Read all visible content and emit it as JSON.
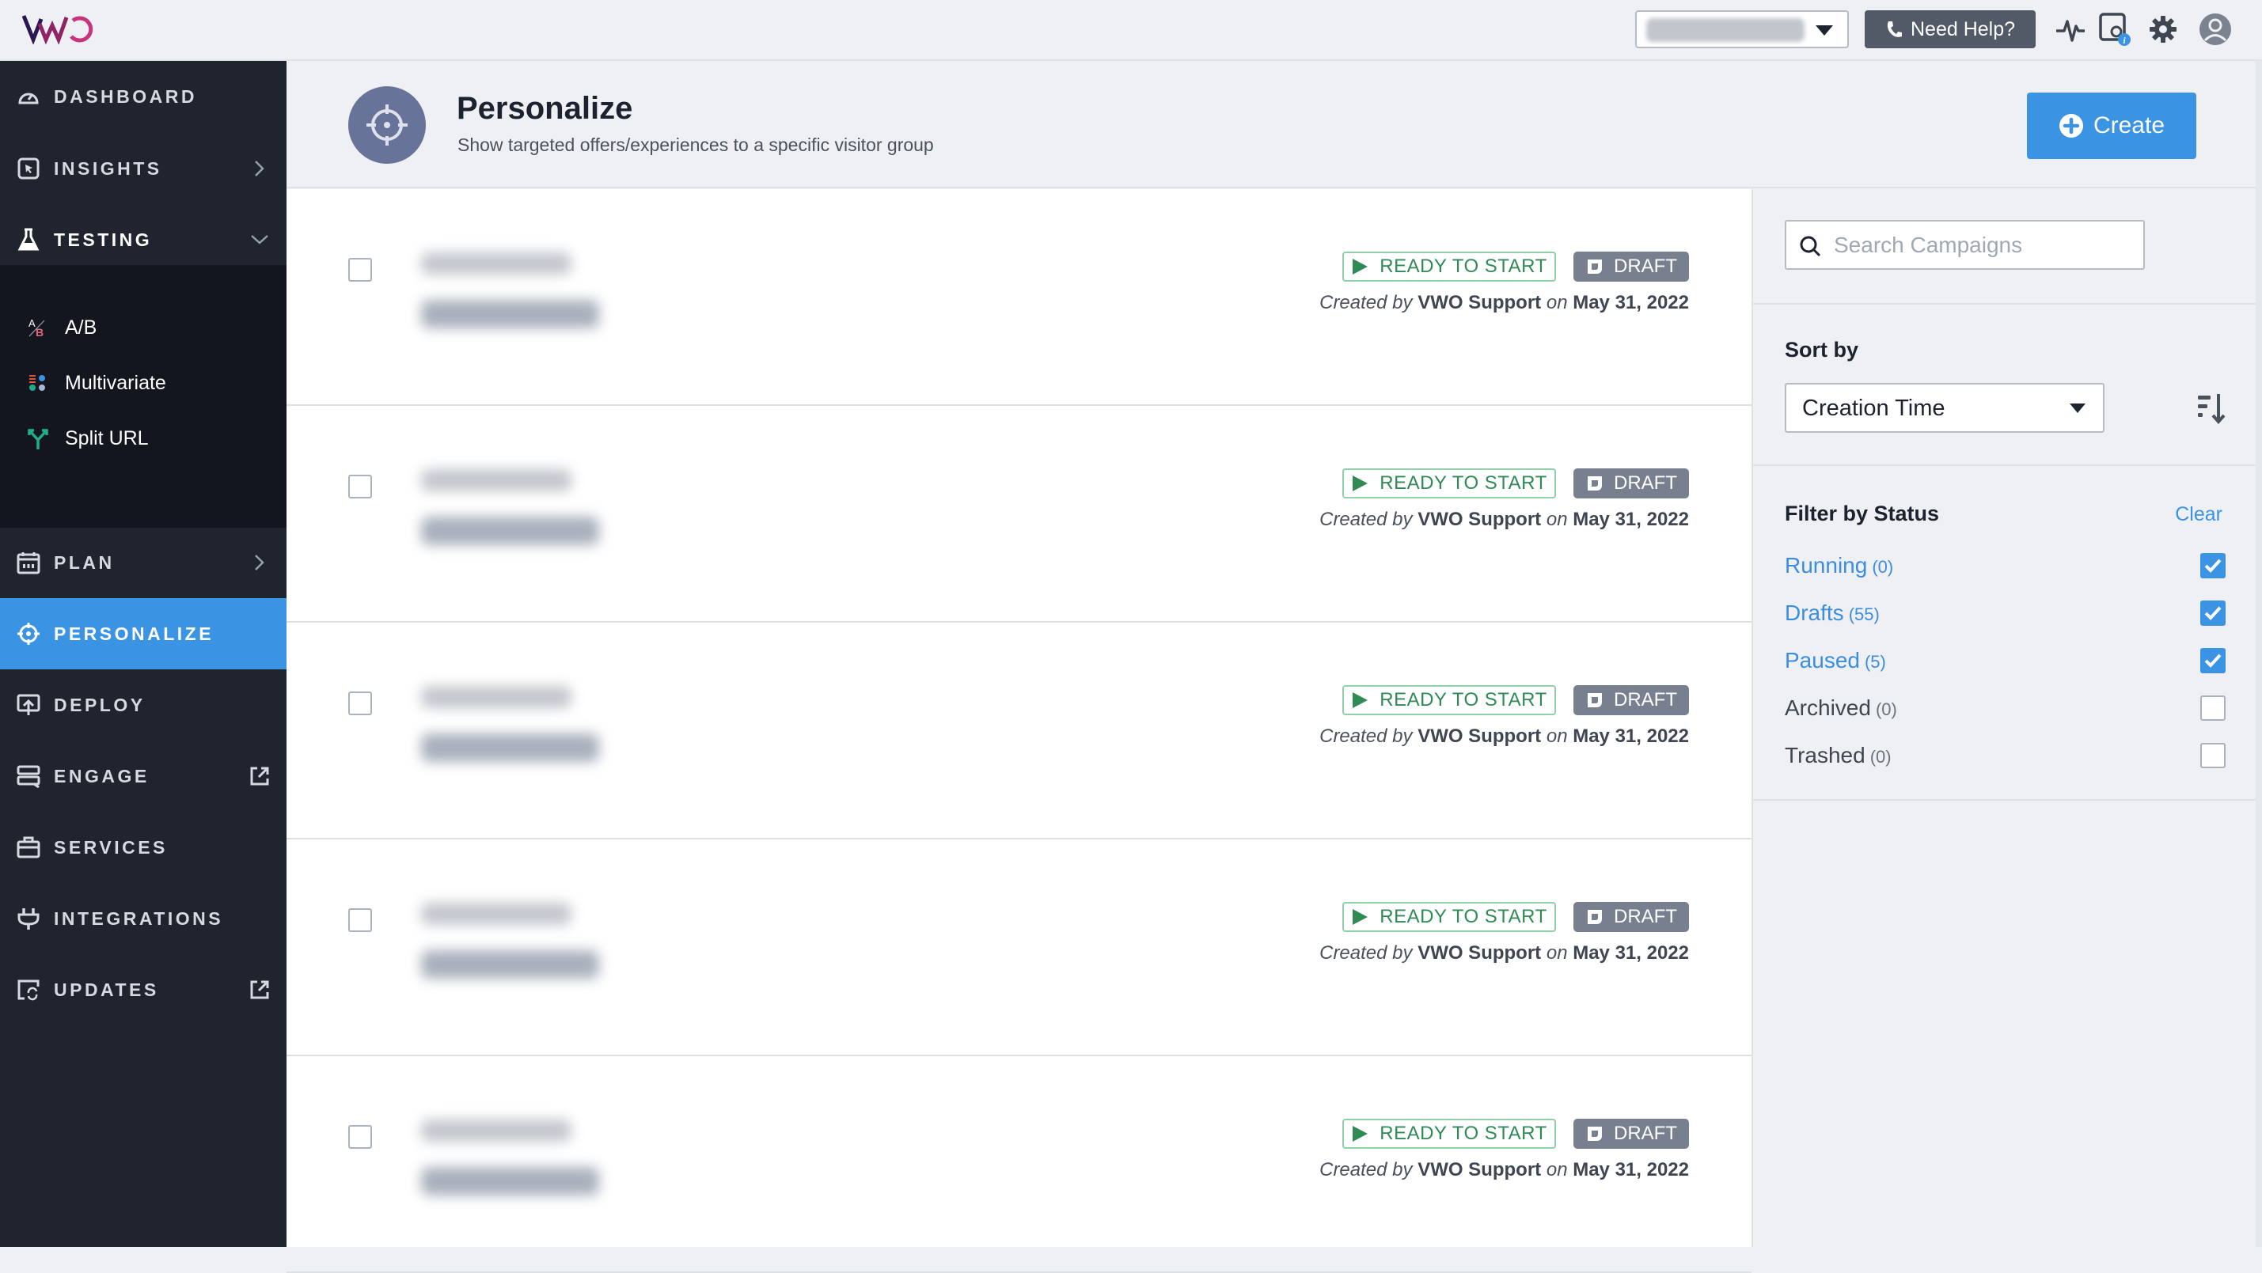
{
  "app": {
    "logo_text": "VWO",
    "account_selector": {
      "value_blurred": true
    },
    "help_button": "Need Help?",
    "top_icons": [
      "activity-icon",
      "settings-info-icon",
      "gear-icon",
      "user-avatar-icon"
    ]
  },
  "sidebar": {
    "items": [
      {
        "label": "DASHBOARD",
        "icon": "dashboard-gauge-icon",
        "trail": ""
      },
      {
        "label": "INSIGHTS",
        "icon": "insights-cursor-icon",
        "trail": "chevron-right"
      },
      {
        "label": "TESTING",
        "icon": "flask-icon",
        "trail": "chevron-down"
      },
      {
        "label": "PLAN",
        "icon": "calendar-icon",
        "trail": "chevron-right"
      },
      {
        "label": "PERSONALIZE",
        "icon": "target-icon",
        "trail": "",
        "active": true
      },
      {
        "label": "DEPLOY",
        "icon": "deploy-upload-icon",
        "trail": ""
      },
      {
        "label": "ENGAGE",
        "icon": "engage-chat-icon",
        "trail": "external-link"
      },
      {
        "label": "SERVICES",
        "icon": "briefcase-icon",
        "trail": ""
      },
      {
        "label": "INTEGRATIONS",
        "icon": "plug-icon",
        "trail": ""
      },
      {
        "label": "UPDATES",
        "icon": "updates-icon",
        "trail": "external-link"
      }
    ],
    "testing_sub": [
      {
        "label": "A/B",
        "icon": "ab-test-icon"
      },
      {
        "label": "Multivariate",
        "icon": "multivariate-icon"
      },
      {
        "label": "Split URL",
        "icon": "split-url-icon"
      }
    ]
  },
  "header": {
    "title": "Personalize",
    "subtitle": "Show targeted offers/experiences to a specific visitor group",
    "create_label": "Create"
  },
  "campaigns": [
    {
      "name_blurred": true,
      "status": "READY TO START",
      "badge": "DRAFT",
      "created_by_prefix": "Created by",
      "author": "VWO Support",
      "on": "on",
      "date": "May 31, 2022"
    },
    {
      "name_blurred": true,
      "status": "READY TO START",
      "badge": "DRAFT",
      "created_by_prefix": "Created by",
      "author": "VWO Support",
      "on": "on",
      "date": "May 31, 2022"
    },
    {
      "name_blurred": true,
      "status": "READY TO START",
      "badge": "DRAFT",
      "created_by_prefix": "Created by",
      "author": "VWO Support",
      "on": "on",
      "date": "May 31, 2022"
    },
    {
      "name_blurred": true,
      "status": "READY TO START",
      "badge": "DRAFT",
      "created_by_prefix": "Created by",
      "author": "VWO Support",
      "on": "on",
      "date": "May 31, 2022"
    },
    {
      "name_blurred": true,
      "status": "READY TO START",
      "badge": "DRAFT",
      "created_by_prefix": "Created by",
      "author": "VWO Support",
      "on": "on",
      "date": "May 31, 2022"
    }
  ],
  "panel": {
    "search_placeholder": "Search Campaigns",
    "search_value": "",
    "sort_label": "Sort by",
    "sort_value": "Creation Time",
    "filter_label": "Filter by Status",
    "clear_label": "Clear",
    "filters": [
      {
        "label": "Running",
        "count": "(0)",
        "checked": true
      },
      {
        "label": "Drafts",
        "count": "(55)",
        "checked": true
      },
      {
        "label": "Paused",
        "count": "(5)",
        "checked": true
      },
      {
        "label": "Archived",
        "count": "(0)",
        "checked": false
      },
      {
        "label": "Trashed",
        "count": "(0)",
        "checked": false
      }
    ]
  },
  "colors": {
    "accent": "#3b93e3",
    "sidebar_bg": "#20242f",
    "sidebar_section_bg": "#13161e",
    "ready_green": "#2f8a55",
    "draft_gray": "#787f8f",
    "logo_dark": "#2a1650",
    "logo_pink": "#c7347a"
  }
}
